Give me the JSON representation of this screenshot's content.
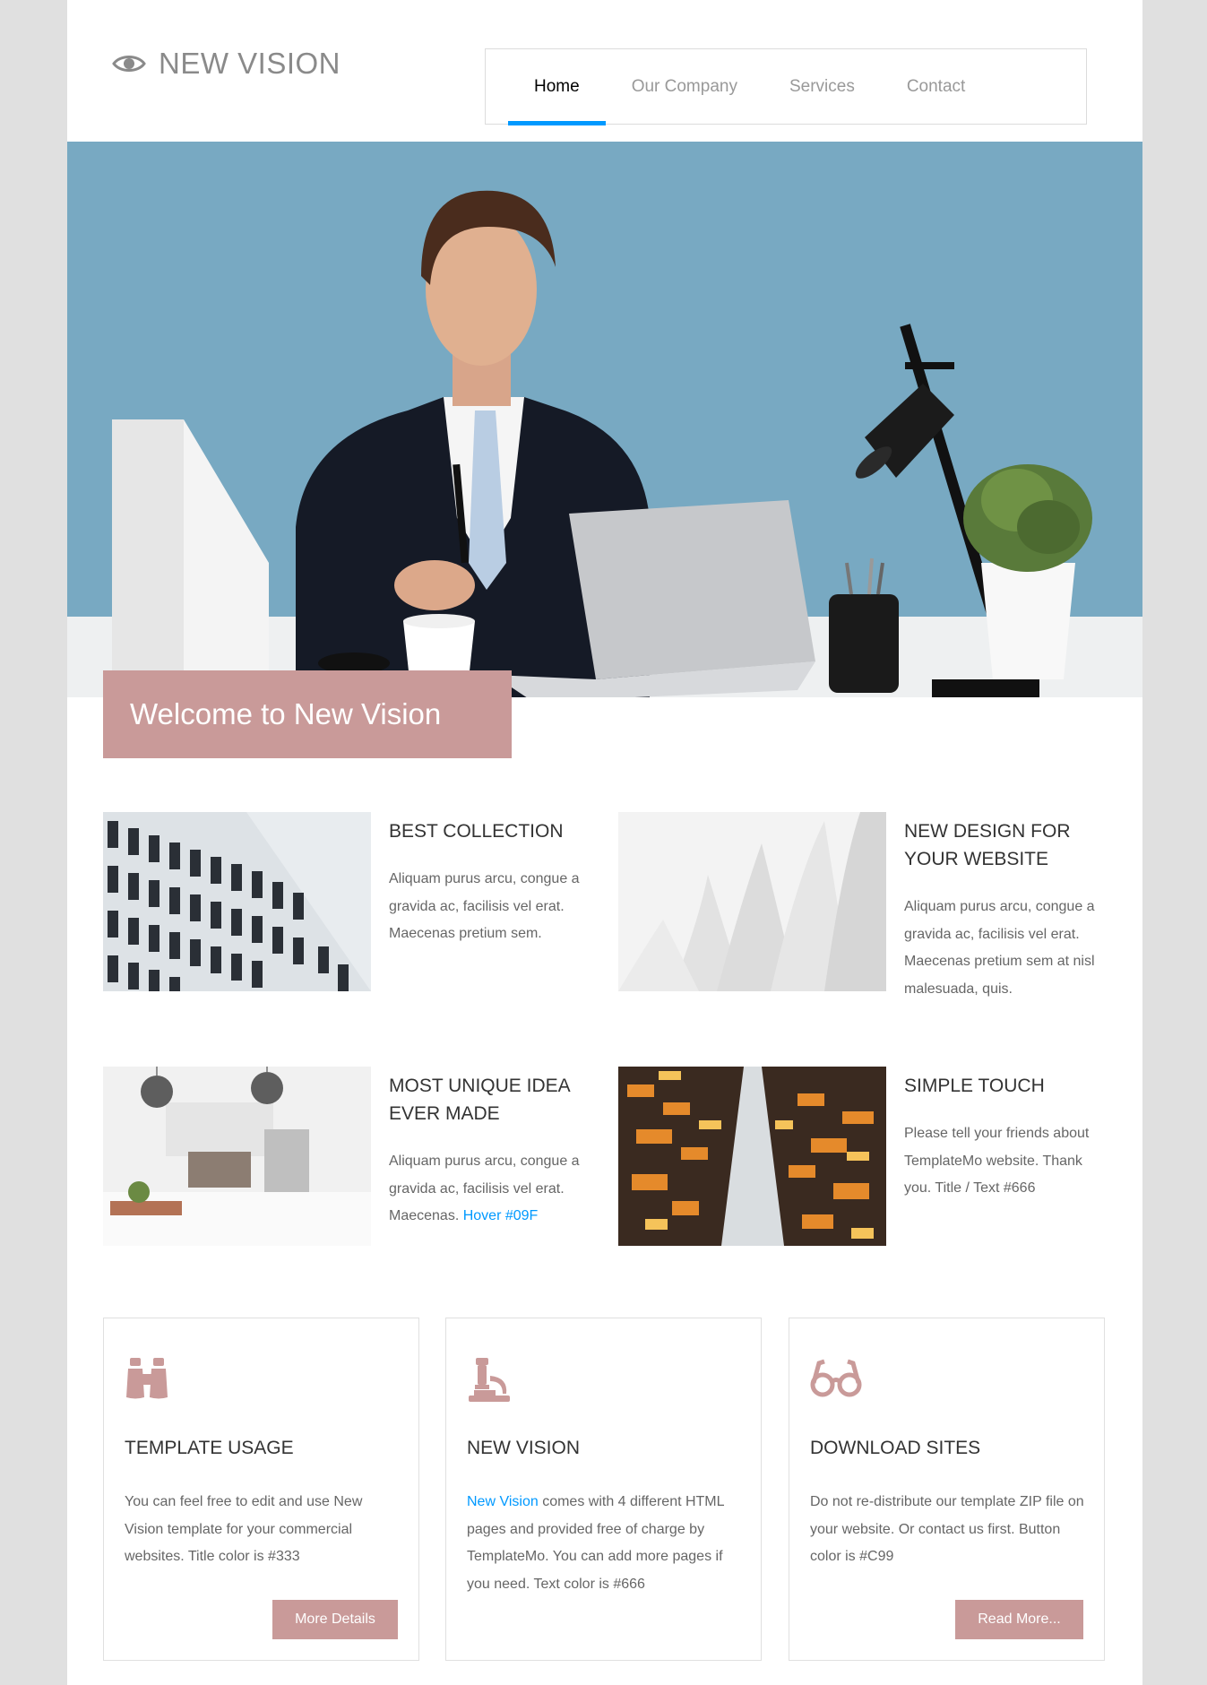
{
  "header": {
    "logo_text": "NEW VISION",
    "logo_icon": "eye-icon",
    "nav": [
      {
        "label": "Home",
        "active": true
      },
      {
        "label": "Our Company",
        "active": false
      },
      {
        "label": "Services",
        "active": false
      },
      {
        "label": "Contact",
        "active": false
      }
    ]
  },
  "hero": {
    "welcome": "Welcome to New Vision"
  },
  "features": [
    {
      "title": "BEST COLLECTION",
      "text": "Aliquam purus arcu, congue a gravida ac, facilisis vel erat. Maecenas pretium sem."
    },
    {
      "title": "NEW DESIGN FOR YOUR WEBSITE",
      "text": "Aliquam purus arcu, congue a gravida ac, facilisis vel erat. Maecenas pretium sem at nisl malesuada, quis."
    },
    {
      "title": "MOST UNIQUE IDEA EVER MADE",
      "text": "Aliquam purus arcu, congue a gravida ac, facilisis vel erat. Maecenas.",
      "link": "Hover #09F"
    },
    {
      "title": "SIMPLE TOUCH",
      "text": "Please tell your friends about TemplateMo website. Thank you. Title / Text #666"
    }
  ],
  "cards": [
    {
      "icon": "binoculars-icon",
      "title": "TEMPLATE USAGE",
      "text": "You can feel free to edit and use New Vision template for your commercial websites. Title color is #333",
      "button": "More Details"
    },
    {
      "icon": "microscope-icon",
      "title": "NEW VISION",
      "link": "New Vision",
      "text": " comes with 4 different HTML pages and provided free of charge by TemplateMo. You can add more pages if you need. Text color is #666",
      "button": ""
    },
    {
      "icon": "glasses-icon",
      "title": "DOWNLOAD SITES",
      "text": "Do not re-distribute our template ZIP file on your website. Or contact us first. Button color is #C99",
      "button": "Read More..."
    }
  ],
  "colors": {
    "accent": "#C99A99",
    "link": "#0099FF",
    "title": "#333333",
    "text": "#666666",
    "hero_bg": "#78A9C2"
  }
}
